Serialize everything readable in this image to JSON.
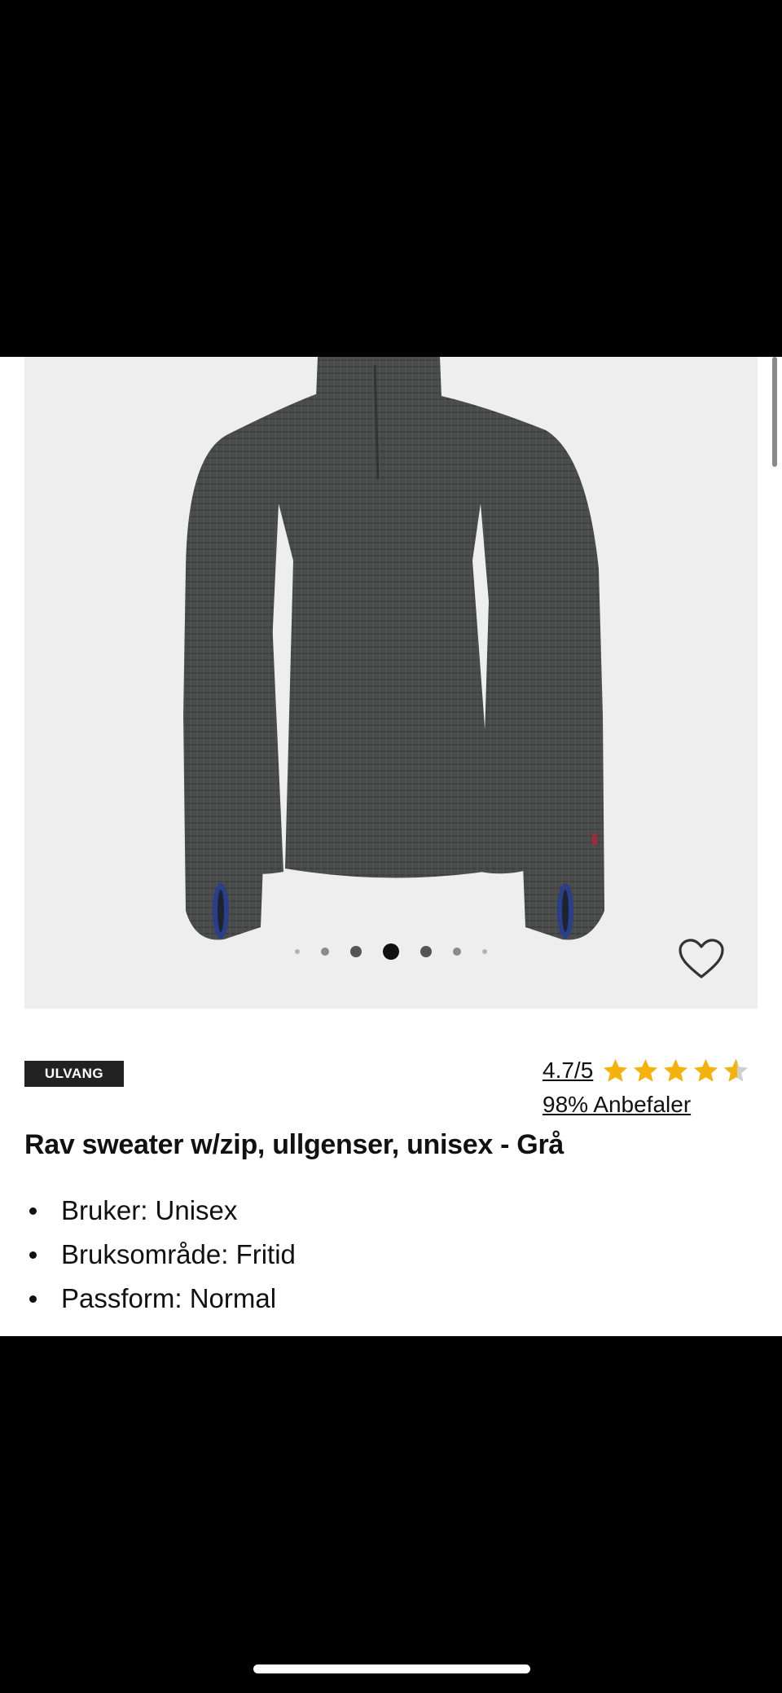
{
  "product": {
    "image_alt": "Rav sweater w/zip, ullgenser, unisex - Grå",
    "gallery": {
      "total_images": 7,
      "active_index": 4
    },
    "brand": "ULVANG",
    "rating": {
      "score_text": "4.7/5",
      "value": 4.7,
      "max": 5,
      "recommend_text": "98% Anbefaler"
    },
    "title": "Rav sweater w/zip, ullgenser, unisex - Grå",
    "bullets": [
      "Bruker: Unisex",
      "Bruksområde: Fritid",
      "Passform: Normal"
    ]
  },
  "colors": {
    "star": "#f5b20a",
    "brand_badge": "#222222",
    "image_background": "#eeeeee"
  },
  "icons": {
    "favorite": "heart-icon",
    "rating": "star-icon"
  }
}
